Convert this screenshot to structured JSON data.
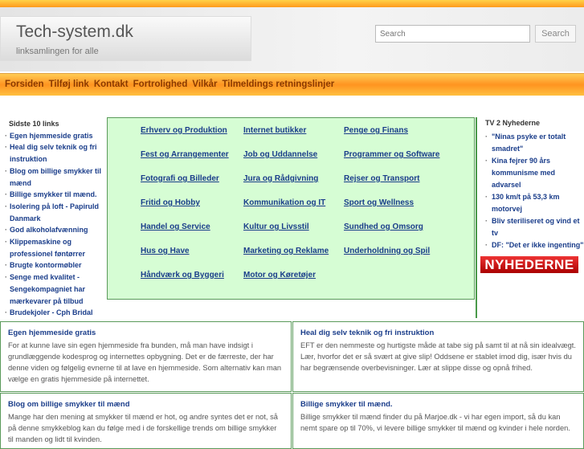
{
  "header": {
    "title": "Tech-system.dk",
    "tagline": "linksamlingen for alle",
    "search_placeholder": "Search",
    "search_button": "Search"
  },
  "nav": [
    "Forsiden",
    "Tilføj link",
    "Kontakt",
    "Fortrolighed",
    "Vilkår",
    "Tilmeldings retningslinjer"
  ],
  "recent": {
    "title": "Sidste 10 links",
    "items": [
      "Egen hjemmeside gratis",
      "Heal dig selv teknik og fri instruktion",
      "Blog om billige smykker til mænd",
      "Billige smykker til mænd.",
      "Isolering på loft - Papiruld Danmark",
      "God alkoholafvænning",
      "Klippemaskine og professionel føntørrer",
      "Brugte kontormøbler",
      "Senge med kvalitet - Sengekompagniet har mærkevarer på tilbud",
      "Brudekjoler - Cph Bridal"
    ]
  },
  "categories": [
    [
      "Erhverv og Produktion",
      "Fest og Arrangementer",
      "Fotografi og Billeder",
      "Fritid og Hobby",
      "Handel og Service",
      "Hus og Have",
      "Håndværk og Byggeri"
    ],
    [
      "Internet butikker",
      "Job og Uddannelse",
      "Jura og Rådgivning",
      "Kommunikation og IT",
      "Kultur og Livsstil",
      "Marketing og Reklame",
      "Motor og Køretøjer"
    ],
    [
      "Penge og Finans",
      "Programmer og Software",
      "Rejser og Transport",
      "Sport og Wellness",
      "Sundhed og Omsorg",
      "Underholdning og Spil"
    ]
  ],
  "news": {
    "title": "TV 2 Nyhederne",
    "items": [
      "\"Ninas psyke er totalt smadret\"",
      "Kina fejrer 90 års kommunisme med advarsel",
      "130 km/t på 53,3 km motorvej",
      "Bliv steriliseret og vind et tv",
      "DF: \"Det er ikke ingenting\""
    ],
    "logo": "NYHEDERNE"
  },
  "cards": [
    {
      "title": "Egen hjemmeside gratis",
      "text": "For at kunne lave sin egen hjemmeside fra bunden, må man have indsigt i grundlæggende kodesprog og internettes opbygning. Det er de færreste, der har denne viden og følgelig evnerne til at lave en hjemmeside. Som alternativ kan man vælge en gratis hjemmeside på internettet."
    },
    {
      "title": "Heal dig selv teknik og fri instruktion",
      "text": "EFT er den nemmeste og hurtigste måde at tabe sig på samt til at nå sin idealvægt. Lær, hvorfor det er så svært at give slip! Oddsene er stablet imod dig, især hvis du har begrænsende overbevisninger. Lær at slippe disse og opnå frihed."
    },
    {
      "title": "Blog om billige smykker til mænd",
      "text": "Mange har den mening at smykker til mænd er hot, og andre syntes det er not, så på denne smykkeblog kan du følge med i de forskellige trends om billige smykker til manden og lidt til kvinden."
    },
    {
      "title": "Billige smykker til mænd.",
      "text": "Billige smykker til mænd finder du på Marjoe.dk - vi har egen import, så du kan nemt spare op til 70%, vi levere billige smykker til mænd og kvinder i hele norden."
    }
  ]
}
